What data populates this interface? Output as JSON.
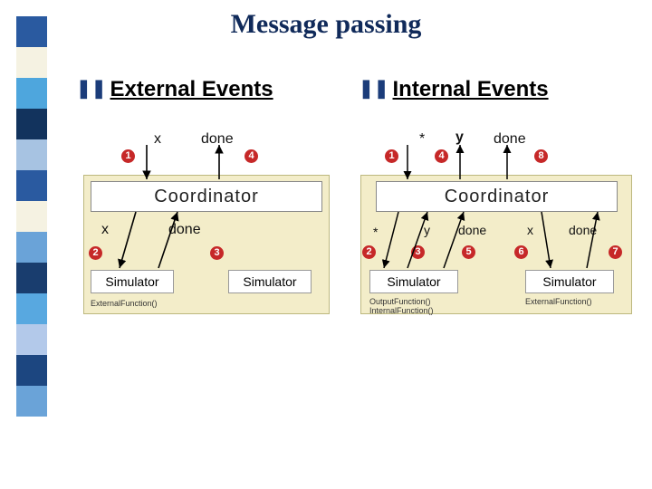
{
  "title": "Message passing",
  "headings": {
    "left": "External Events",
    "right": "Internal Events"
  },
  "labels": {
    "x": "x",
    "y": "y",
    "done": "done",
    "star": "*",
    "coordinator": "Coordinator",
    "simulator": "Simulator"
  },
  "fns": {
    "ext": "ExternalFunction()",
    "out_int": "OutputFunction()\nInternalFunction()"
  },
  "nums": {
    "1": "1",
    "2": "2",
    "3": "3",
    "4": "4",
    "5": "5",
    "6": "6",
    "7": "7",
    "8": "8"
  },
  "sidebar_colors": [
    "#2a5aa0",
    "#f5f2e2",
    "#4ea6dd",
    "#12335d",
    "#a7c3e2",
    "#2a5aa0",
    "#f5f2e2",
    "#6aa3d8",
    "#193d6e",
    "#58a8e0",
    "#b3c9ea",
    "#1c4680",
    "#6aa3d8"
  ]
}
